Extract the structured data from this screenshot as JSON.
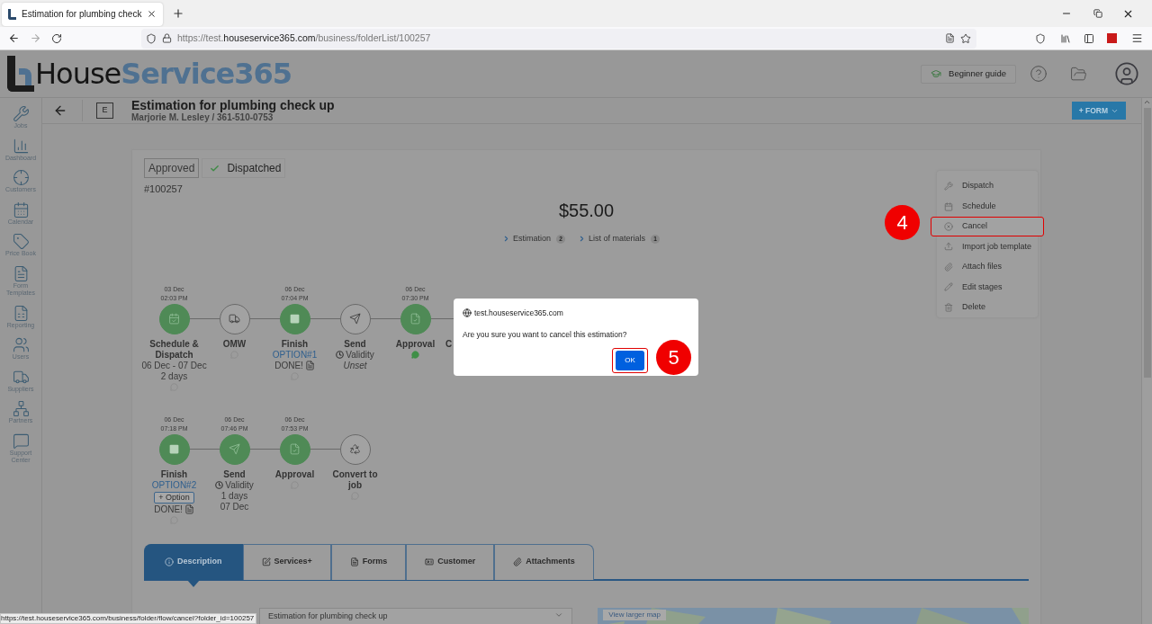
{
  "browser": {
    "tab_title": "Estimation for plumbing check",
    "url": "https://test.**houseservice365.com**/business/folderList/100257"
  },
  "header": {
    "logo_dark": "House",
    "logo_accent": "Service365",
    "guide_button": "Beginner guide"
  },
  "sidebar": [
    {
      "label": "Jobs"
    },
    {
      "label": "Dashboard"
    },
    {
      "label": "Customers"
    },
    {
      "label": "Calendar"
    },
    {
      "label": "Price Book"
    },
    {
      "label": "Form Templates"
    },
    {
      "label": "Reporting"
    },
    {
      "label": "Users"
    },
    {
      "label": "Suppliers"
    },
    {
      "label": "Partners"
    },
    {
      "label": "Support Center"
    }
  ],
  "title_bar": {
    "badge": "E",
    "title": "Estimation for plumbing check up",
    "subtitle": "Marjorie M. Lesley / 361-510-0753",
    "form_button": "+ FORM"
  },
  "card": {
    "statuses": [
      {
        "label": "Approved",
        "checked": false
      },
      {
        "label": "Dispatched",
        "checked": true
      }
    ],
    "number": "#100257",
    "total": "$55.00",
    "links": [
      {
        "label": "Estimation",
        "count": "2"
      },
      {
        "label": "List of materials",
        "count": "1"
      }
    ],
    "rows": [
      {
        "nodes": [
          {
            "kind": "schedule",
            "done": true,
            "date": "03 Dec",
            "time": "02:03 PM",
            "label": "Schedule & Dispatch",
            "lines": [
              {
                "kind": "text",
                "text": "06 Dec - 07 Dec"
              },
              {
                "kind": "text",
                "text": "2 days"
              }
            ],
            "comment": {
              "active": false
            }
          },
          {
            "kind": "omw",
            "done": false,
            "label": "OMW",
            "comment": {
              "active": false
            }
          },
          {
            "kind": "finish",
            "done": true,
            "date": "06 Dec",
            "time": "07:04 PM",
            "label": "Finish",
            "lines": [
              {
                "kind": "link",
                "text": "OPTION#1"
              },
              {
                "kind": "done",
                "text": "DONE!"
              }
            ],
            "comment": {
              "active": false
            }
          },
          {
            "kind": "send",
            "done": false,
            "label": "Send",
            "lines": [
              {
                "kind": "validity",
                "text": "Validity"
              },
              {
                "kind": "italic",
                "text": "Unset"
              }
            ]
          },
          {
            "kind": "approval",
            "done": true,
            "date": "06 Dec",
            "time": "07:30 PM",
            "label": "Approval",
            "comment": {
              "active": true
            }
          },
          {
            "kind": "covered",
            "label": "C"
          }
        ]
      },
      {
        "nodes": [
          {
            "kind": "finish",
            "done": true,
            "date": "06 Dec",
            "time": "07:18 PM",
            "label": "Finish",
            "lines": [
              {
                "kind": "link",
                "text": "OPTION#2"
              },
              {
                "kind": "button",
                "text": "+ Option"
              },
              {
                "kind": "done",
                "text": "DONE!"
              }
            ],
            "comment": {
              "active": false
            }
          },
          {
            "kind": "send",
            "done": true,
            "date": "06 Dec",
            "time": "07:46 PM",
            "label": "Send",
            "lines": [
              {
                "kind": "validity",
                "text": "Validity"
              },
              {
                "kind": "text",
                "text": "1 days"
              },
              {
                "kind": "text",
                "text": "07 Dec"
              }
            ]
          },
          {
            "kind": "approval",
            "done": true,
            "date": "06 Dec",
            "time": "07:53 PM",
            "label": "Approval",
            "comment": {
              "active": false
            }
          },
          {
            "kind": "convert",
            "done": false,
            "label": "Convert to job",
            "comment": {
              "active": false
            }
          }
        ]
      }
    ]
  },
  "actions_menu": [
    {
      "label": "Dispatch",
      "selected": false
    },
    {
      "label": "Schedule",
      "selected": false
    },
    {
      "label": "Cancel",
      "selected": true
    },
    {
      "label": "Import job template",
      "selected": false
    },
    {
      "label": "Attach files",
      "selected": false
    },
    {
      "label": "Edit stages",
      "selected": false
    },
    {
      "label": "Delete",
      "selected": false
    }
  ],
  "tabs": [
    {
      "label": "Description",
      "selected": true
    },
    {
      "label": "Services+",
      "selected": false
    },
    {
      "label": "Forms",
      "selected": false
    },
    {
      "label": "Customer",
      "selected": false
    },
    {
      "label": "Attachments",
      "selected": false
    }
  ],
  "form_field": {
    "value": "Estimation for plumbing check up"
  },
  "map": {
    "button": "View larger map"
  },
  "dialog": {
    "origin": "test.houseservice365.com",
    "message": "Are you sure you want to cancel this estimation?",
    "ok_button": "OK"
  },
  "callouts": [
    {
      "number": "4"
    },
    {
      "number": "5"
    }
  ],
  "status_bar": "https://test.houseservice365.com/business/folder/flow/cancel?folder_id=100257"
}
